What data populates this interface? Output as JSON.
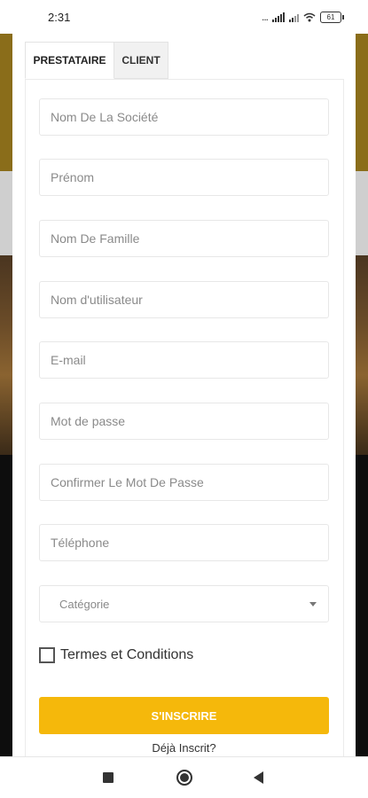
{
  "status": {
    "time": "2:31",
    "signal_dots": "...",
    "battery": "61",
    "icons": [
      "signal-dots-icon",
      "signal-bars-icon",
      "signal-bars-icon",
      "wifi-icon",
      "battery-icon"
    ]
  },
  "tabs": [
    {
      "label": "PRESTATAIRE",
      "active": true
    },
    {
      "label": "CLIENT",
      "active": false
    }
  ],
  "form": {
    "company_placeholder": "Nom De La Société",
    "firstname_placeholder": "Prénom",
    "lastname_placeholder": "Nom De Famille",
    "username_placeholder": "Nom d'utilisateur",
    "email_placeholder": "E-mail",
    "password_placeholder": "Mot de passe",
    "confirm_password_placeholder": "Confirmer Le Mot De Passe",
    "phone_placeholder": "Téléphone",
    "category_label": "Catégorie",
    "terms_label": "Termes et Conditions",
    "terms_checked": false,
    "submit_label": "S'INSCRIRE",
    "login_link": "Déjà Inscrit?"
  },
  "colors": {
    "accent": "#f5b80b",
    "header_band": "#8a6d1a"
  },
  "navbar": {
    "icons": [
      "recent-apps-icon",
      "home-icon",
      "back-icon"
    ]
  }
}
